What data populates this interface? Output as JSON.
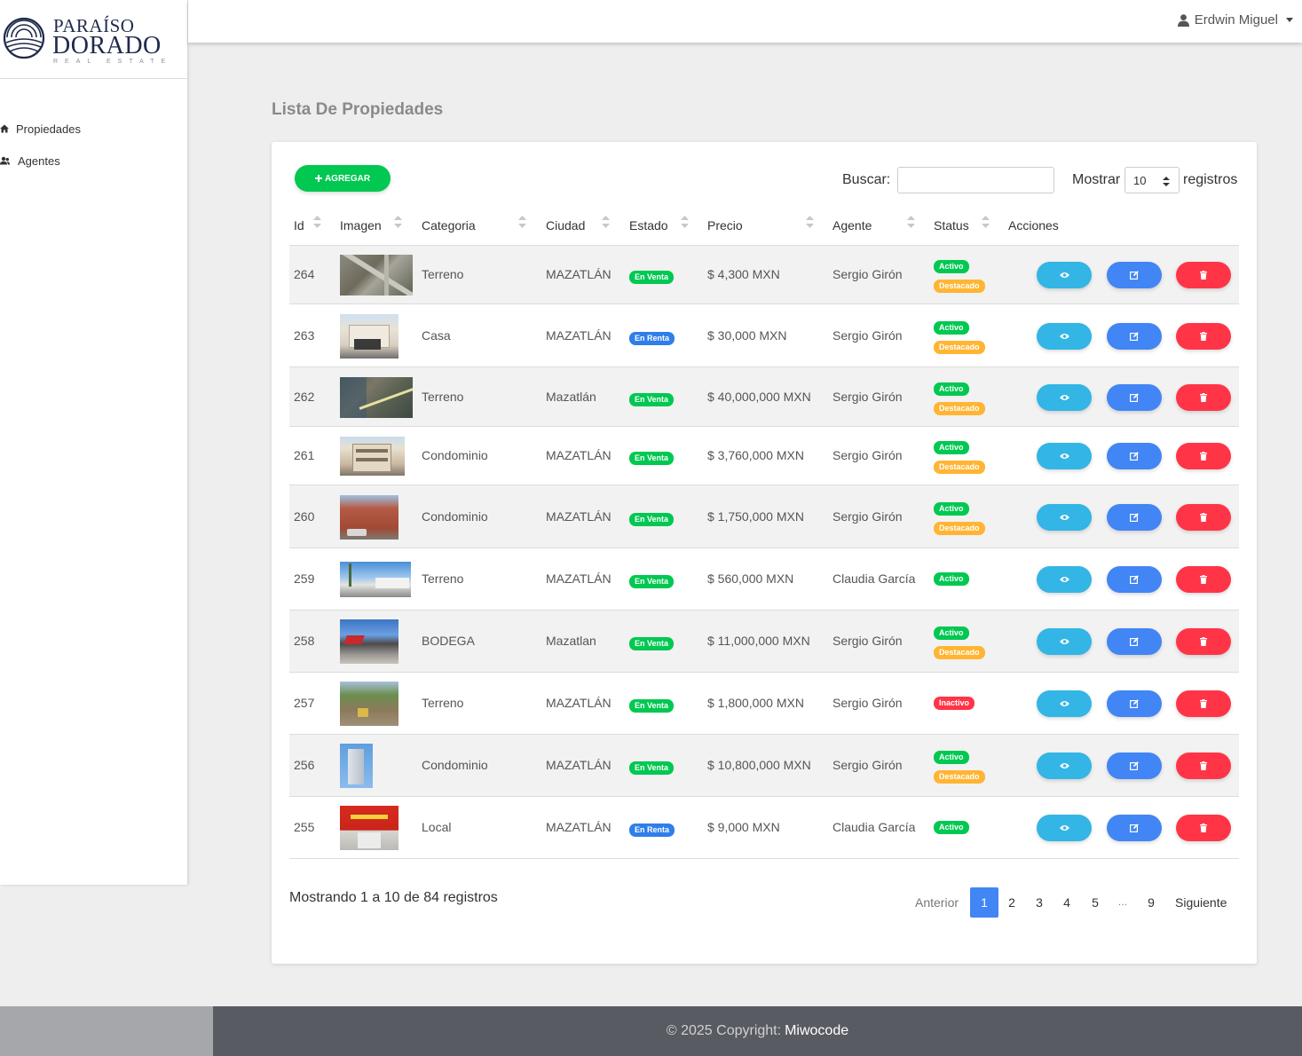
{
  "brand": {
    "line1": "PARAÍSO",
    "line2": "DORADO",
    "line3": "REAL ESTATE"
  },
  "header": {
    "user_name": "Erdwin Miguel"
  },
  "sidebar": {
    "items": [
      {
        "label": "Propiedades",
        "icon": "home-icon"
      },
      {
        "label": "Agentes",
        "icon": "users-icon"
      }
    ]
  },
  "page": {
    "title": "Lista De Propiedades"
  },
  "toolbar": {
    "add_label": "AGREGAR",
    "search_label": "Buscar:",
    "search_value": "",
    "show_label": "Mostrar",
    "show_value": "10",
    "records_label": "registros"
  },
  "table": {
    "columns": [
      "Id",
      "Imagen",
      "Categoria",
      "Ciudad",
      "Estado",
      "Precio",
      "Agente",
      "Status",
      "Acciones"
    ],
    "rows": [
      {
        "id": "264",
        "categoria": "Terreno",
        "ciudad": "MAZATLÁN",
        "estado": "En Venta",
        "precio": "$ 4,300 MXN",
        "agente": "Sergio Girón",
        "status": [
          "Activo",
          "Destacado"
        ],
        "img": "aerial"
      },
      {
        "id": "263",
        "categoria": "Casa",
        "ciudad": "MAZATLÁN",
        "estado": "En Renta",
        "precio": "$ 30,000 MXN",
        "agente": "Sergio Girón",
        "status": [
          "Activo",
          "Destacado"
        ],
        "img": "house"
      },
      {
        "id": "262",
        "categoria": "Terreno",
        "ciudad": "Mazatlán",
        "estado": "En Venta",
        "precio": "$ 40,000,000 MXN",
        "agente": "Sergio Girón",
        "status": [
          "Activo",
          "Destacado"
        ],
        "img": "satellite"
      },
      {
        "id": "261",
        "categoria": "Condominio",
        "ciudad": "MAZATLÁN",
        "estado": "En Venta",
        "precio": "$ 3,760,000 MXN",
        "agente": "Sergio Girón",
        "status": [
          "Activo",
          "Destacado"
        ],
        "img": "condo"
      },
      {
        "id": "260",
        "categoria": "Condominio",
        "ciudad": "MAZATLÁN",
        "estado": "En Venta",
        "precio": "$ 1,750,000 MXN",
        "agente": "Sergio Girón",
        "status": [
          "Activo",
          "Destacado"
        ],
        "img": "brick"
      },
      {
        "id": "259",
        "categoria": "Terreno",
        "ciudad": "MAZATLÁN",
        "estado": "En Venta",
        "precio": "$ 560,000 MXN",
        "agente": "Claudia García",
        "status": [
          "Activo"
        ],
        "img": "street"
      },
      {
        "id": "258",
        "categoria": "BODEGA",
        "ciudad": "Mazatlan",
        "estado": "En Venta",
        "precio": "$ 11,000,000 MXN",
        "agente": "Sergio Girón",
        "status": [
          "Activo",
          "Destacado"
        ],
        "img": "warehouse"
      },
      {
        "id": "257",
        "categoria": "Terreno",
        "ciudad": "MAZATLÁN",
        "estado": "En Venta",
        "precio": "$ 1,800,000 MXN",
        "agente": "Sergio Girón",
        "status": [
          "Inactivo"
        ],
        "img": "lot"
      },
      {
        "id": "256",
        "categoria": "Condominio",
        "ciudad": "MAZATLÁN",
        "estado": "En Venta",
        "precio": "$ 10,800,000 MXN",
        "agente": "Sergio Girón",
        "status": [
          "Activo",
          "Destacado"
        ],
        "img": "tower"
      },
      {
        "id": "255",
        "categoria": "Local",
        "ciudad": "MAZATLÁN",
        "estado": "En Renta",
        "precio": "$ 9,000 MXN",
        "agente": "Claudia García",
        "status": [
          "Activo"
        ],
        "img": "store"
      }
    ]
  },
  "pagination": {
    "summary": "Mostrando 1 a 10 de 84 registros",
    "prev": "Anterior",
    "pages": [
      "1",
      "2",
      "3",
      "4",
      "5",
      "…",
      "9"
    ],
    "active": "1",
    "next": "Siguiente"
  },
  "footer": {
    "copyright": "© 2025 Copyright:",
    "brand": "Miwocode"
  },
  "colors": {
    "green": "#00c851",
    "blue": "#2f7eea",
    "orange": "#ffb533",
    "red": "#ff3547",
    "info": "#33b5e5",
    "primary": "#4285f4"
  }
}
